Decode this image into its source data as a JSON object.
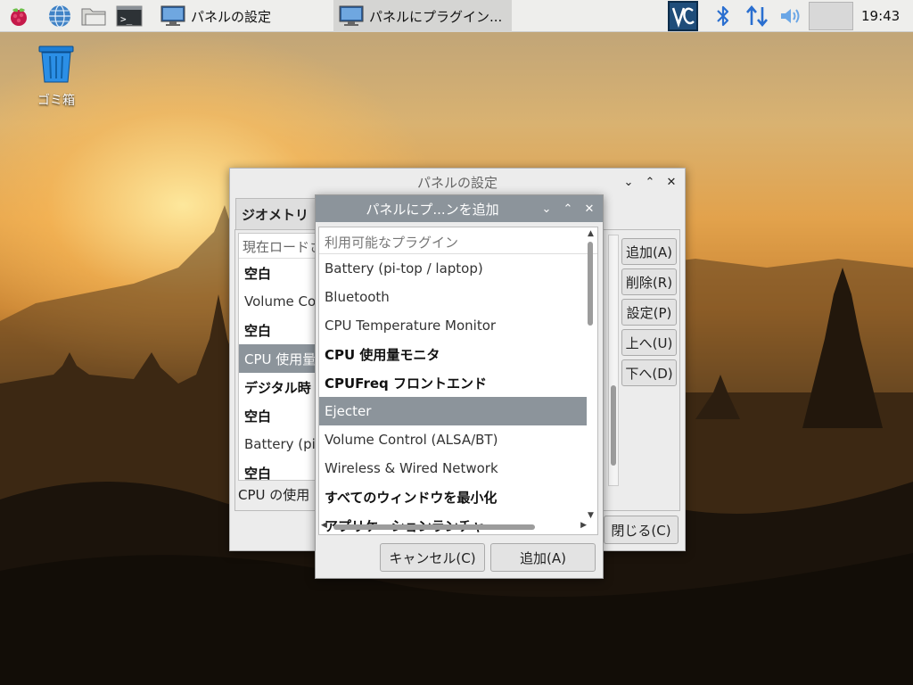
{
  "taskbar": {
    "tasks": [
      {
        "label": "パネルの設定",
        "active": false
      },
      {
        "label": "パネルにプラグイン...",
        "active": true
      }
    ],
    "clock": "19:43"
  },
  "desktop": {
    "trash_label": "ゴミ箱"
  },
  "panel_settings": {
    "title": "パネルの設定",
    "tab_geometry": "ジオメトリ",
    "loaded_header": "現在ロードさ",
    "loaded_items": [
      {
        "label": "空白",
        "bold": true,
        "selected": false
      },
      {
        "label": "Volume Cor",
        "bold": false,
        "selected": false
      },
      {
        "label": "空白",
        "bold": true,
        "selected": false
      },
      {
        "label": "CPU 使用量",
        "bold": false,
        "selected": true
      },
      {
        "label": "デジタル時",
        "bold": true,
        "selected": false
      },
      {
        "label": "空白",
        "bold": true,
        "selected": false
      },
      {
        "label": "Battery (pi-t",
        "bold": false,
        "selected": false
      },
      {
        "label": "空白",
        "bold": true,
        "selected": false
      }
    ],
    "description": "CPU の使用",
    "buttons": {
      "add": "追加(A)",
      "remove": "削除(R)",
      "settings": "設定(P)",
      "up": "上へ(U)",
      "down": "下へ(D)"
    },
    "close": "閉じる(C)"
  },
  "add_plugin": {
    "title": "パネルにプ...ンを追加",
    "header": "利用可能なプラグイン",
    "items": [
      {
        "label": "Battery (pi-top / laptop)",
        "bold": false,
        "selected": false
      },
      {
        "label": "Bluetooth",
        "bold": false,
        "selected": false
      },
      {
        "label": "CPU Temperature Monitor",
        "bold": false,
        "selected": false
      },
      {
        "label": "CPU 使用量モニタ",
        "bold": true,
        "selected": false
      },
      {
        "label": "CPUFreq フロントエンド",
        "bold": true,
        "selected": false
      },
      {
        "label": "Ejecter",
        "bold": false,
        "selected": true
      },
      {
        "label": "Volume Control (ALSA/BT)",
        "bold": false,
        "selected": false
      },
      {
        "label": "Wireless & Wired Network",
        "bold": false,
        "selected": false
      },
      {
        "label": "すべてのウィンドウを最小化",
        "bold": true,
        "selected": false
      },
      {
        "label": "アプリケーションランチャ",
        "bold": true,
        "selected": false
      }
    ],
    "cancel": "キャンセル(C)",
    "add": "追加(A)"
  },
  "colors": {
    "selection": "#8c949b",
    "taskbar": "#eeeeec"
  }
}
